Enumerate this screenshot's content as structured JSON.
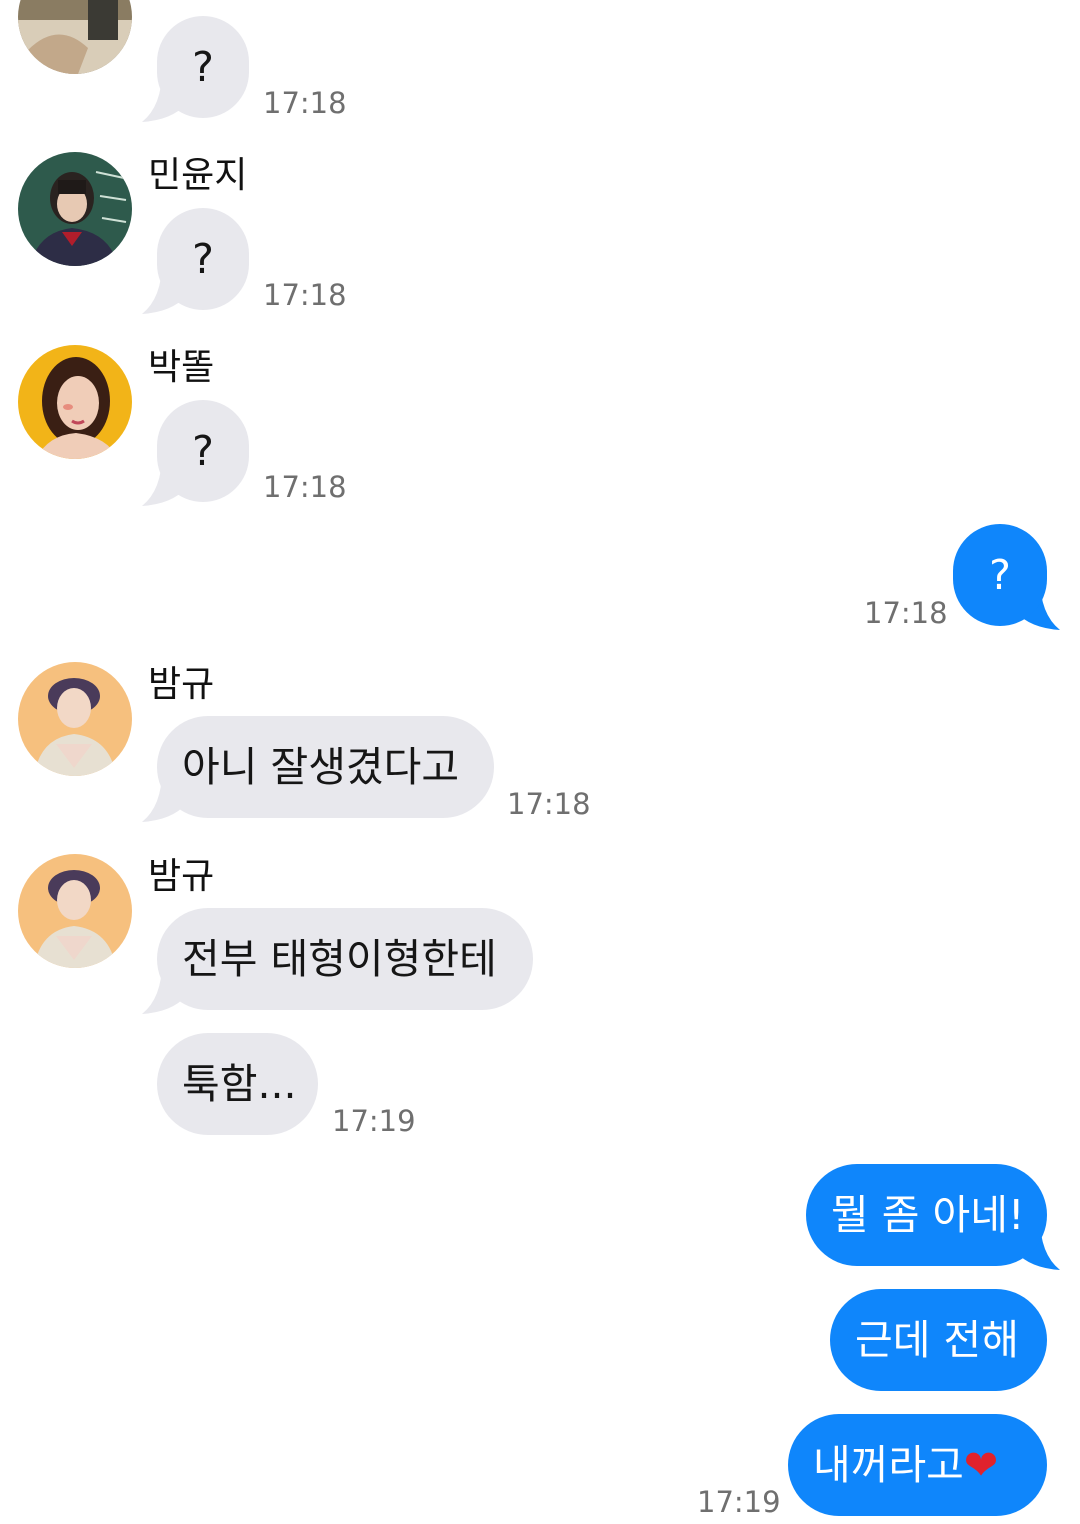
{
  "chat": {
    "messages": [
      {
        "text": "?",
        "time": "17:18"
      },
      {
        "sender": "민윤지",
        "text": "?",
        "time": "17:18"
      },
      {
        "sender": "박똘",
        "text": "?",
        "time": "17:18"
      },
      {
        "text": "?",
        "time": "17:18"
      },
      {
        "sender": "밤규",
        "text": "아니 잘생겼다고",
        "time": "17:18"
      },
      {
        "sender": "밤규",
        "text": "전부 태형이형한테"
      },
      {
        "text": "툭함...",
        "time": "17:19"
      },
      {
        "text": "뭘 좀 아네!"
      },
      {
        "text": "근데 전해"
      },
      {
        "text": "내꺼라고",
        "emoji": "❤",
        "time": "17:19"
      }
    ]
  },
  "colors": {
    "outgoing_bubble": "#0f86fb",
    "incoming_bubble": "#e8e8ed",
    "timestamp": "#6f6f6f"
  }
}
